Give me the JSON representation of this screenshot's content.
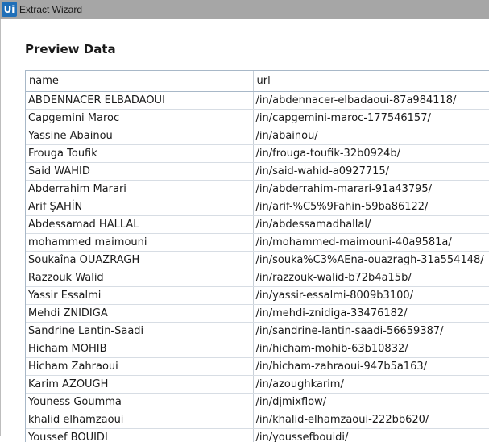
{
  "window": {
    "title": "Extract Wizard",
    "icon": "uipath-icon"
  },
  "heading": "Preview Data",
  "table": {
    "columns": [
      "name",
      "url"
    ],
    "rows": [
      [
        "ABDENNACER ELBADAOUI",
        "/in/abdennacer-elbadaoui-87a984118/"
      ],
      [
        "Capgemini Maroc",
        "/in/capgemini-maroc-177546157/"
      ],
      [
        "Yassine Abainou",
        "/in/abainou/"
      ],
      [
        "Frouga Toufik",
        "/in/frouga-toufik-32b0924b/"
      ],
      [
        "Said WAHID",
        "/in/said-wahid-a0927715/"
      ],
      [
        "Abderrahim Marari",
        "/in/abderrahim-marari-91a43795/"
      ],
      [
        "Arif ŞAHİN",
        "/in/arif-%C5%9Fahin-59ba86122/"
      ],
      [
        "Abdessamad HALLAL",
        "/in/abdessamadhallal/"
      ],
      [
        "mohammed maimouni",
        "/in/mohammed-maimouni-40a9581a/"
      ],
      [
        "Soukaîna OUAZRAGH",
        "/in/souka%C3%AEna-ouazragh-31a554148/"
      ],
      [
        "Razzouk Walid",
        "/in/razzouk-walid-b72b4a15b/"
      ],
      [
        "Yassir Essalmi",
        "/in/yassir-essalmi-8009b3100/"
      ],
      [
        "Mehdi ZNIDIGA",
        "/in/mehdi-znidiga-33476182/"
      ],
      [
        "Sandrine Lantin-Saadi",
        "/in/sandrine-lantin-saadi-56659387/"
      ],
      [
        "Hicham MOHIB",
        "/in/hicham-mohib-63b10832/"
      ],
      [
        "Hicham Zahraoui",
        "/in/hicham-zahraoui-947b5a163/"
      ],
      [
        "Karim AZOUGH",
        "/in/azoughkarim/"
      ],
      [
        "Youness Goumma",
        "/in/djmixflow/"
      ],
      [
        "khalid elhamzaoui",
        "/in/khalid-elhamzaoui-222bb620/"
      ],
      [
        "Youssef BOUIDI",
        "/in/youssefbouidi/"
      ]
    ]
  }
}
